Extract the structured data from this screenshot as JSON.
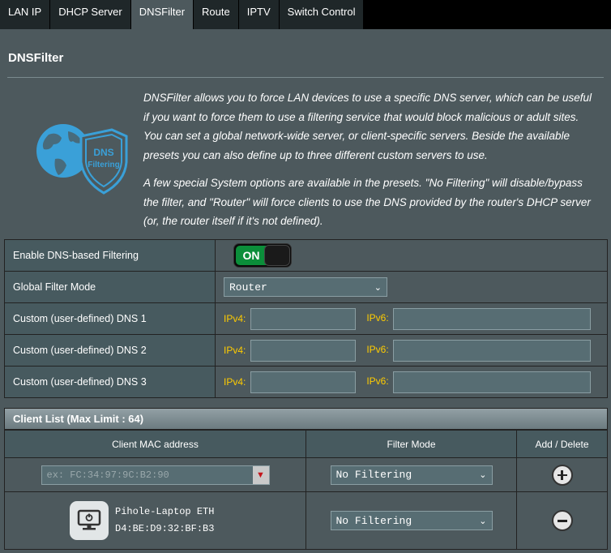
{
  "tabs": [
    {
      "label": "LAN IP",
      "active": false
    },
    {
      "label": "DHCP Server",
      "active": false
    },
    {
      "label": "DNSFilter",
      "active": true
    },
    {
      "label": "Route",
      "active": false
    },
    {
      "label": "IPTV",
      "active": false
    },
    {
      "label": "Switch Control",
      "active": false
    }
  ],
  "page": {
    "title": "DNSFilter",
    "logo_text_line1": "DNS",
    "logo_text_line2": "Filtering",
    "description_p1": "DNSFilter allows you to force LAN devices to use a specific DNS server, which can be useful if you want to force them to use a filtering service that would block malicious or adult sites. You can set a global network-wide server, or client-specific servers. Beside the available presets you can also define up to three different custom servers to use.",
    "description_p2": "A few special System options are available in the presets. \"No Filtering\" will disable/bypass the filter, and \"Router\" will force clients to use the DNS provided by the router's DHCP server (or, the router itself if it's not defined)."
  },
  "settings": {
    "enable_label": "Enable DNS-based Filtering",
    "enable_value": "ON",
    "mode_label": "Global Filter Mode",
    "mode_value": "Router",
    "custom_dns": [
      {
        "label": "Custom (user-defined) DNS 1",
        "ipv4_label": "IPv4:",
        "ipv4": "",
        "ipv6_label": "IPv6:",
        "ipv6": ""
      },
      {
        "label": "Custom (user-defined) DNS 2",
        "ipv4_label": "IPv4:",
        "ipv4": "",
        "ipv6_label": "IPv6:",
        "ipv6": ""
      },
      {
        "label": "Custom (user-defined) DNS 3",
        "ipv4_label": "IPv4:",
        "ipv4": "",
        "ipv6_label": "IPv6:",
        "ipv6": ""
      }
    ]
  },
  "client_list": {
    "title": "Client List (Max Limit : 64)",
    "columns": [
      "Client MAC address",
      "Filter Mode",
      "Add / Delete"
    ],
    "new_entry": {
      "mac_placeholder": "ex: FC:34:97:9C:B2:90",
      "filter_mode": "No Filtering"
    },
    "clients": [
      {
        "name": "Pihole-Laptop ETH",
        "mac": "D4:BE:D9:32:BF:B3",
        "filter_mode": "No Filtering"
      }
    ]
  },
  "colors": {
    "background": "#4d595d",
    "toggle_on": "#0b8e3a",
    "ip_label": "#ffcc00",
    "logo_blue": "#3aa0d8"
  }
}
